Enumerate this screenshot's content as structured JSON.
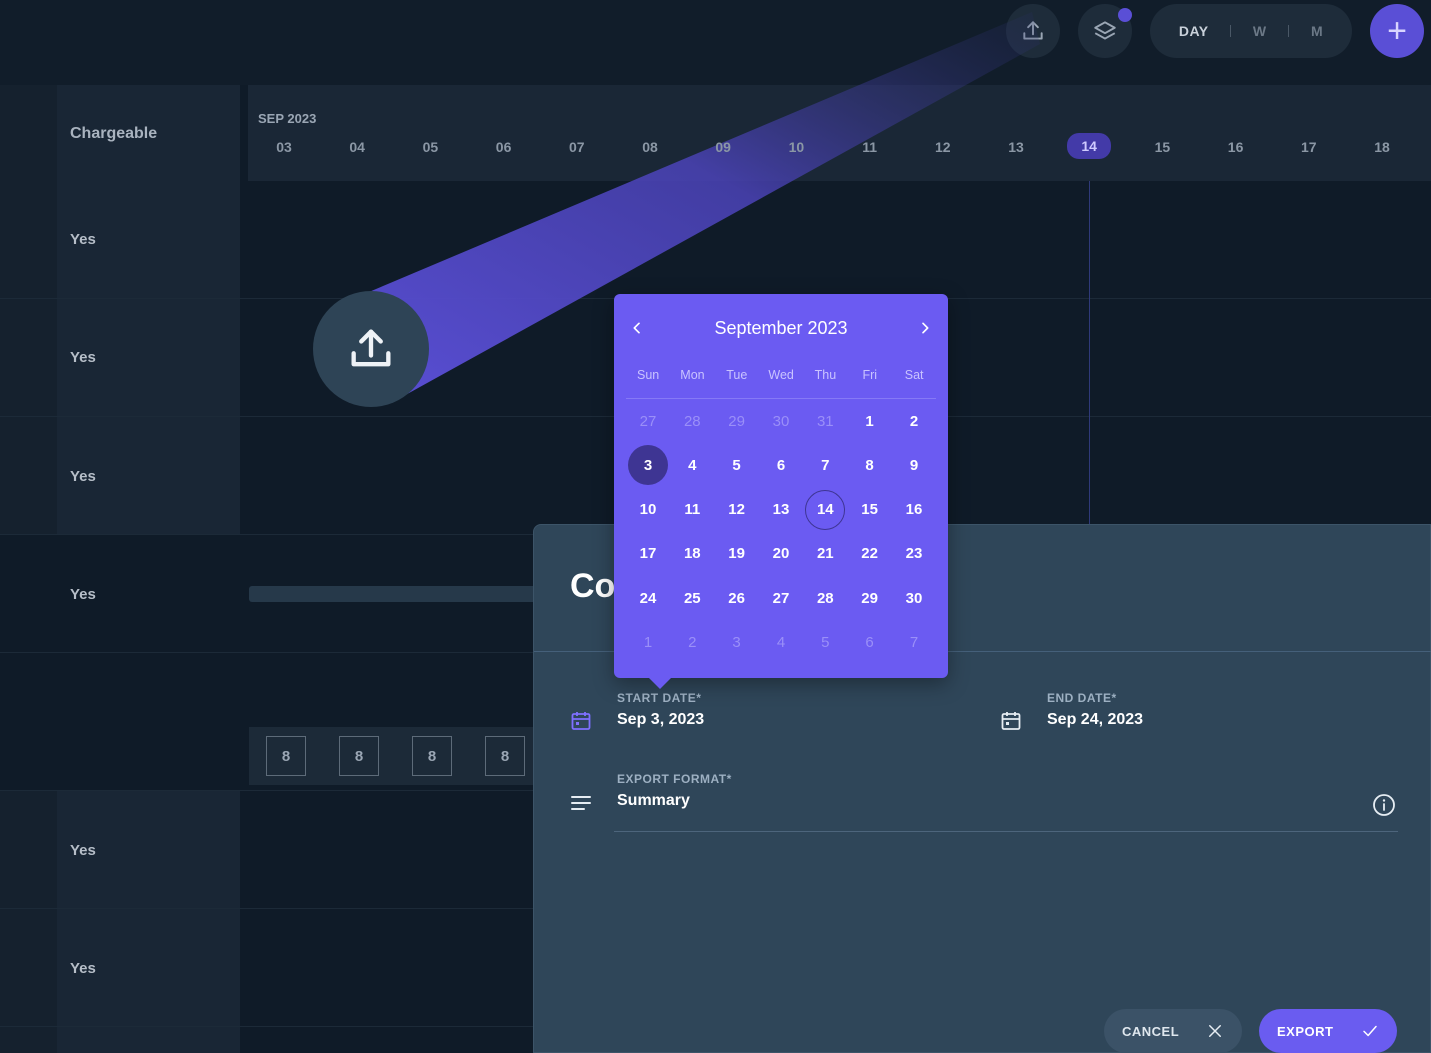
{
  "topbar": {
    "upload_icon": "upload-icon",
    "layers_icon": "layers-icon",
    "view_options": [
      "DAY",
      "W",
      "M"
    ],
    "active_view": "DAY",
    "add_icon": "plus-icon"
  },
  "left": {
    "header": "Chargeable",
    "rows": [
      "Yes",
      "Yes",
      "Yes",
      "Yes",
      "",
      "Yes",
      "Yes"
    ]
  },
  "timeline": {
    "month": "SEP 2023",
    "days": [
      "03",
      "04",
      "05",
      "06",
      "07",
      "08",
      "09",
      "10",
      "11",
      "12",
      "13",
      "14",
      "15",
      "16",
      "17",
      "18"
    ],
    "today": "14",
    "hours": [
      "8",
      "8",
      "8",
      "8"
    ]
  },
  "dialog": {
    "title_partial": "Co",
    "start_label": "START DATE*",
    "start_value": "Sep 3, 2023",
    "end_label": "END DATE*",
    "end_value": "Sep 24, 2023",
    "format_label": "EXPORT FORMAT*",
    "format_value": "Summary",
    "cancel_label": "CANCEL",
    "export_label": "EXPORT"
  },
  "calendar": {
    "title": "September 2023",
    "weekdays": [
      "Sun",
      "Mon",
      "Tue",
      "Wed",
      "Thu",
      "Fri",
      "Sat"
    ],
    "weeks": [
      [
        "27",
        "28",
        "29",
        "30",
        "31",
        "1",
        "2"
      ],
      [
        "3",
        "4",
        "5",
        "6",
        "7",
        "8",
        "9"
      ],
      [
        "10",
        "11",
        "12",
        "13",
        "14",
        "15",
        "16"
      ],
      [
        "17",
        "18",
        "19",
        "20",
        "21",
        "22",
        "23"
      ],
      [
        "24",
        "25",
        "26",
        "27",
        "28",
        "29",
        "30"
      ],
      [
        "1",
        "2",
        "3",
        "4",
        "5",
        "6",
        "7"
      ]
    ],
    "muted": [
      [
        0,
        0
      ],
      [
        0,
        1
      ],
      [
        0,
        2
      ],
      [
        0,
        3
      ],
      [
        0,
        4
      ],
      [
        5,
        0
      ],
      [
        5,
        1
      ],
      [
        5,
        2
      ],
      [
        5,
        3
      ],
      [
        5,
        4
      ],
      [
        5,
        5
      ],
      [
        5,
        6
      ]
    ],
    "selected": [
      1,
      0
    ],
    "today": [
      2,
      4
    ]
  },
  "colors": {
    "accent": "#6b5bf2",
    "selected": "#3e3593",
    "background": "#0f1b28",
    "dialog": "#2f4659"
  }
}
